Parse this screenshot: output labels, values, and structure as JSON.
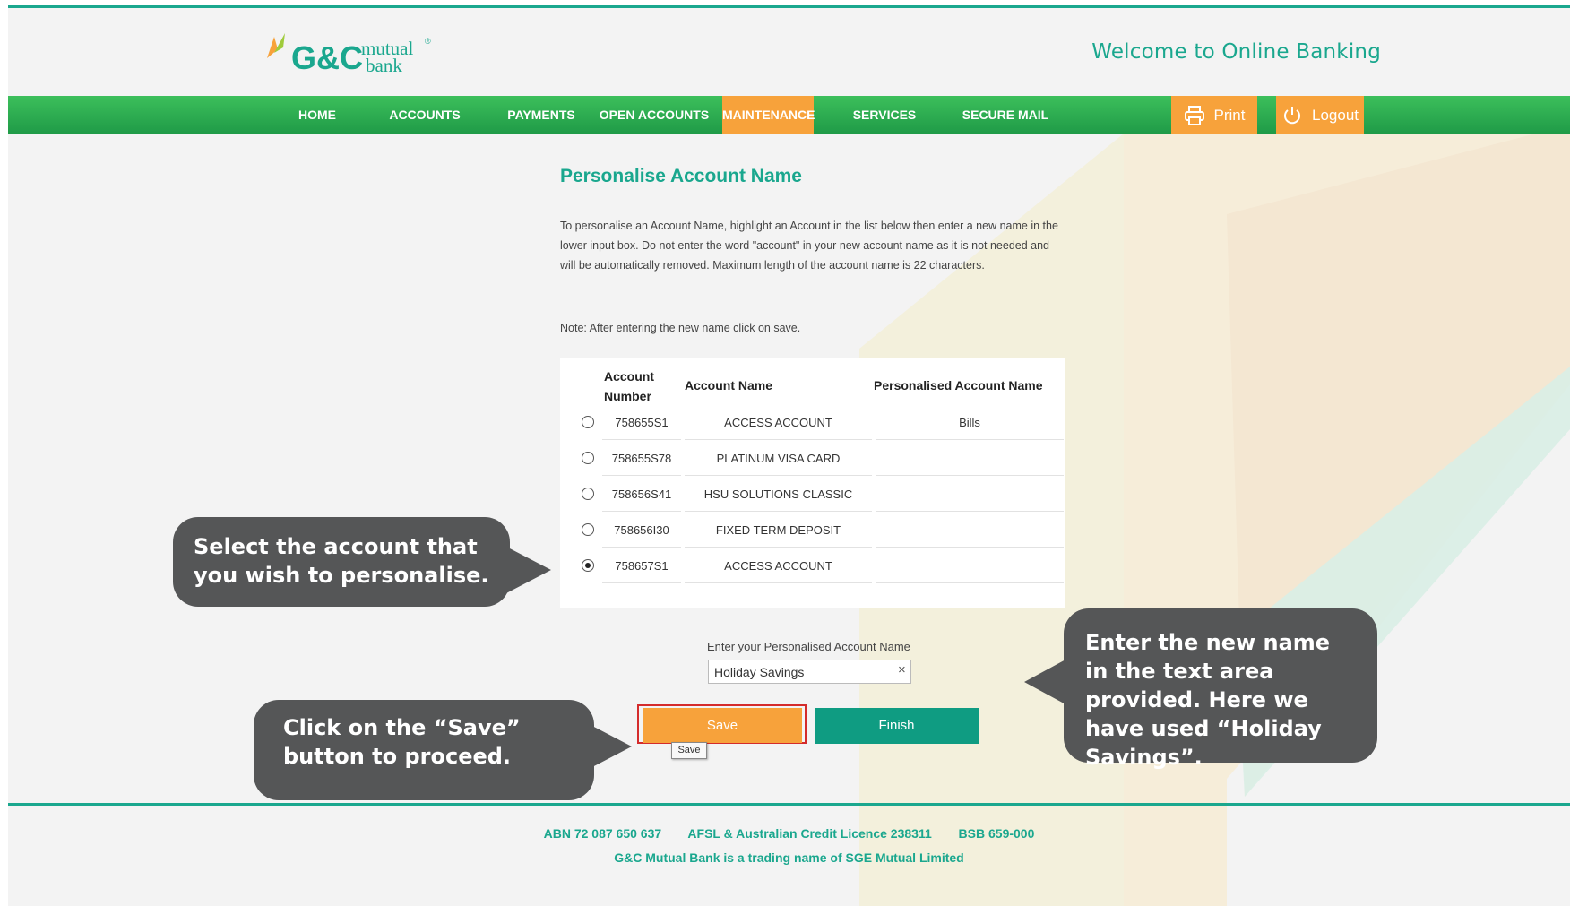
{
  "header": {
    "logo_text": "G&C",
    "logo_sub1": "mutual",
    "logo_sub2": "bank",
    "welcome": "Welcome to Online Banking"
  },
  "nav": {
    "items": [
      "HOME",
      "ACCOUNTS",
      "PAYMENTS",
      "OPEN ACCOUNTS",
      "MAINTENANCE",
      "SERVICES",
      "SECURE MAIL"
    ],
    "active": "MAINTENANCE",
    "print": "Print",
    "logout": "Logout"
  },
  "main": {
    "title": "Personalise Account Name",
    "instructions": "To personalise an Account Name, highlight an Account in the list below then enter a new name in the lower input box. Do not enter the word \"account\" in your new account name as it is not needed and will be automatically removed. Maximum length of the account name is 22 characters.",
    "note": "Note: After entering the new name click on save.",
    "table": {
      "headers": [
        "Account Number",
        "Account Name",
        "Personalised Account Name"
      ],
      "rows": [
        {
          "number": "758655S1",
          "name": "ACCESS ACCOUNT",
          "personalised": "Bills",
          "selected": false
        },
        {
          "number": "758655S78",
          "name": "PLATINUM VISA CARD",
          "personalised": "",
          "selected": false
        },
        {
          "number": "758656S41",
          "name": "HSU SOLUTIONS CLASSIC",
          "personalised": "",
          "selected": false
        },
        {
          "number": "758656I30",
          "name": "FIXED TERM DEPOSIT",
          "personalised": "",
          "selected": false
        },
        {
          "number": "758657S1",
          "name": "ACCESS ACCOUNT",
          "personalised": "",
          "selected": true
        }
      ]
    },
    "input_label": "Enter your Personalised Account Name",
    "input_value": "Holiday Savings",
    "save_label": "Save",
    "finish_label": "Finish",
    "save_tooltip": "Save"
  },
  "footer": {
    "abn": "ABN 72 087 650 637",
    "afsl": "AFSL & Australian Credit Licence 238311",
    "bsb": "BSB 659-000",
    "trading": "G&C Mutual Bank is a trading name of SGE Mutual Limited"
  },
  "callouts": {
    "select": "Select the account that you wish to personalise.",
    "enter": "Enter the new name in the text area provided. Here we have used “Holiday Savings”.",
    "save": "Click on the “Save” button to proceed."
  },
  "colors": {
    "brand_teal": "#1aa78e",
    "nav_green": "#2fae52",
    "accent_orange": "#f7a23b",
    "finish_teal": "#0f9c82",
    "callout_grey": "#555657"
  }
}
